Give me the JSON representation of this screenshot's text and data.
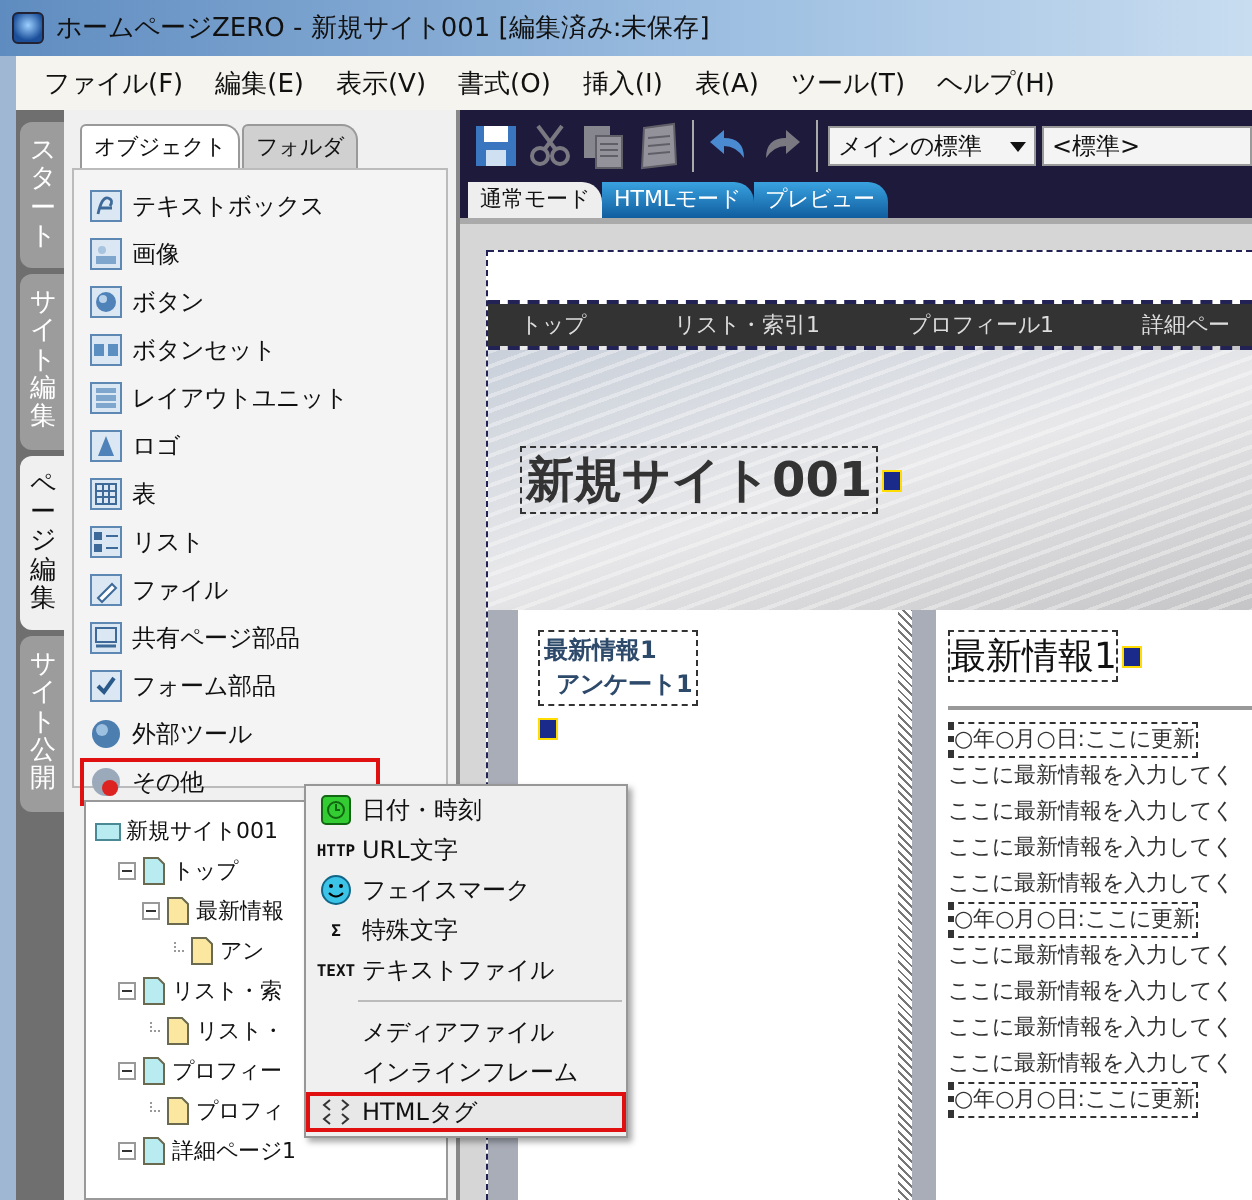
{
  "window": {
    "title": "ホームページZERO - 新規サイト001 [編集済み:未保存]"
  },
  "menu": [
    {
      "label": "ファイル(F)"
    },
    {
      "label": "編集(E)"
    },
    {
      "label": "表示(V)"
    },
    {
      "label": "書式(O)"
    },
    {
      "label": "挿入(I)"
    },
    {
      "label": "表(A)"
    },
    {
      "label": "ツール(T)"
    },
    {
      "label": "ヘルプ(H)"
    }
  ],
  "side_tabs": [
    {
      "label": "スタート",
      "selected": false
    },
    {
      "label": "サイト編集",
      "selected": false
    },
    {
      "label": "ページ編集",
      "selected": true
    },
    {
      "label": "サイト公開",
      "selected": false
    }
  ],
  "panel_tabs": [
    {
      "label": "オブジェクト",
      "selected": true
    },
    {
      "label": "フォルダ",
      "selected": false
    }
  ],
  "objects": [
    {
      "label": "テキストボックス",
      "highlighted": false
    },
    {
      "label": "画像",
      "highlighted": false
    },
    {
      "label": "ボタン",
      "highlighted": false
    },
    {
      "label": "ボタンセット",
      "highlighted": false
    },
    {
      "label": "レイアウトユニット",
      "highlighted": false
    },
    {
      "label": "ロゴ",
      "highlighted": false
    },
    {
      "label": "表",
      "highlighted": false
    },
    {
      "label": "リスト",
      "highlighted": false
    },
    {
      "label": "ファイル",
      "highlighted": false
    },
    {
      "label": "共有ページ部品",
      "highlighted": false
    },
    {
      "label": "フォーム部品",
      "highlighted": false
    },
    {
      "label": "外部ツール",
      "highlighted": false
    },
    {
      "label": "その他",
      "highlighted": true
    }
  ],
  "tree": {
    "label": "新規サイト001",
    "children": [
      {
        "label": "トップ",
        "expanded": true,
        "children": [
          {
            "label": "最新情報",
            "expanded": true,
            "children": [
              {
                "label": "アン"
              }
            ]
          }
        ]
      },
      {
        "label": "リスト・索",
        "expanded": true,
        "children": [
          {
            "label": "リスト・"
          }
        ]
      },
      {
        "label": "プロフィー",
        "expanded": true,
        "children": [
          {
            "label": "プロフィ"
          }
        ]
      },
      {
        "label": "詳細ページ1",
        "expanded": true
      }
    ]
  },
  "context_menu": [
    {
      "kind": "item",
      "label": "日付・時刻",
      "highlighted": false
    },
    {
      "kind": "item",
      "label": "URL文字",
      "icon_text": "HTTP",
      "highlighted": false
    },
    {
      "kind": "item",
      "label": "フェイスマーク",
      "highlighted": false
    },
    {
      "kind": "item",
      "label": "特殊文字",
      "icon_text": "Σ",
      "highlighted": false
    },
    {
      "kind": "item",
      "label": "テキストファイル",
      "icon_text": "TEXT",
      "highlighted": false
    },
    {
      "kind": "separator"
    },
    {
      "kind": "item",
      "label": "メディアファイル",
      "highlighted": false
    },
    {
      "kind": "item",
      "label": "インラインフレーム",
      "highlighted": false
    },
    {
      "kind": "item",
      "label": "HTMLタグ",
      "highlighted": true
    }
  ],
  "toolbar": {
    "tools": [
      {
        "disabled": false
      },
      {
        "disabled": true
      },
      {
        "disabled": true
      },
      {
        "disabled": true
      },
      {
        "disabled": false
      },
      {
        "disabled": true
      }
    ],
    "style_select": "メインの標準",
    "font_select": "<標準>"
  },
  "editor_tabs": [
    {
      "label": "通常モード",
      "selected": true
    },
    {
      "label": "HTMLモード",
      "selected": false
    },
    {
      "label": "プレビュー",
      "selected": false
    }
  ],
  "page": {
    "nav": [
      "トップ",
      "リスト・索引1",
      "プロフィール1",
      "詳細ペー"
    ],
    "site_title": "新規サイト001",
    "sidebar_links": [
      "最新情報1",
      "アンケート1"
    ],
    "heading": "最新情報1",
    "lines": [
      {
        "kind": "date",
        "text": "○年○月○日:ここに更新"
      },
      {
        "kind": "body",
        "text": "ここに最新情報を入力してく"
      },
      {
        "kind": "body",
        "text": "ここに最新情報を入力してく"
      },
      {
        "kind": "body",
        "text": "ここに最新情報を入力してく"
      },
      {
        "kind": "body",
        "text": "ここに最新情報を入力してく"
      },
      {
        "kind": "date",
        "text": "○年○月○日:ここに更新"
      },
      {
        "kind": "body",
        "text": "ここに最新情報を入力してく"
      },
      {
        "kind": "body",
        "text": "ここに最新情報を入力してく"
      },
      {
        "kind": "body",
        "text": "ここに最新情報を入力してく"
      },
      {
        "kind": "body",
        "text": "ここに最新情報を入力してく"
      },
      {
        "kind": "date",
        "text": "○年○月○日:ここに更新"
      }
    ]
  }
}
